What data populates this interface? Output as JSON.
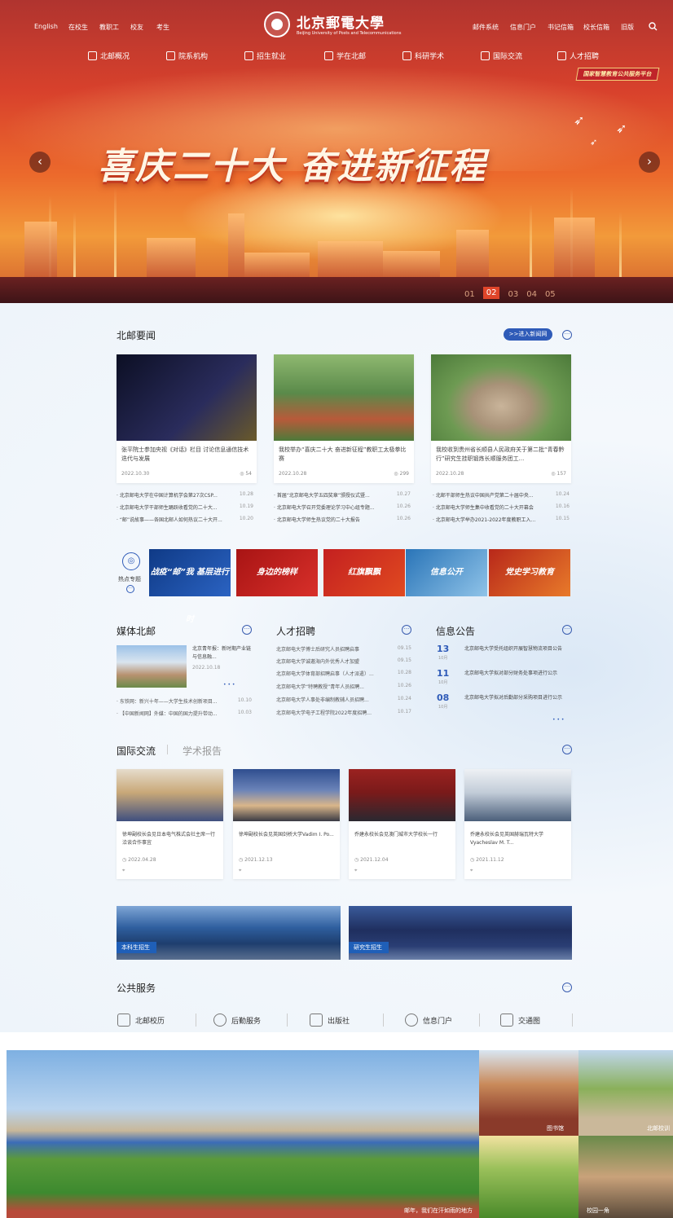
{
  "header": {
    "left_links": [
      "English",
      "在校生",
      "教职工",
      "校友",
      "考生"
    ],
    "logo_cn": "北京郵電大學",
    "logo_en": "Beijing University of Posts and Telecommunications",
    "right_links": [
      "邮件系统",
      "信息门户",
      "书记信箱",
      "校长信箱",
      "旧版"
    ],
    "search_icon": "search-icon"
  },
  "mainnav": [
    "北邮概况",
    "院系机构",
    "招生就业",
    "学在北邮",
    "科研学术",
    "国际交流",
    "人才招聘"
  ],
  "hero": {
    "platform_badge": "国家智慧教育公共服务平台",
    "slogan": "喜庆二十大 奋进新征程",
    "prev": "‹",
    "next": "›",
    "slides": [
      "01",
      "02",
      "03",
      "04",
      "05"
    ],
    "active_slide": "02"
  },
  "news": {
    "title": "北邮要闻",
    "more_pill": ">>进入新闻网",
    "cards": [
      {
        "title": "张平院士参加央视《对话》栏目 讨论信息通信技术迭代与发展",
        "date": "2022.10.30",
        "views": "54",
        "colors": [
          "#0c0f24",
          "#2a2c5c"
        ]
      },
      {
        "title": "我校举办“喜庆二十大 奋进新征程”教职工太极拳比赛",
        "date": "2022.10.28",
        "views": "299",
        "colors": [
          "#5a8a4a",
          "#b85a3a"
        ]
      },
      {
        "title": "我校收到贵州省长顺县人民政府关于第二批“青春黔行”研究生挂职锻炼长顺服务团工...",
        "date": "2022.10.28",
        "views": "157",
        "colors": [
          "#6d9a52",
          "#c9b49a"
        ]
      }
    ],
    "lists": [
      [
        {
          "t": "· 北京邮电大学在中国计算机学会第27次CSP...",
          "d": "10.28"
        },
        {
          "t": "· 北京邮电大学干部师生踊跃收看党的二十大...",
          "d": "10.19"
        },
        {
          "t": "· “邮”说故事——各国北邮人如何热议二十大开...",
          "d": "10.20"
        }
      ],
      [
        {
          "t": "· 首届“北京邮电大学五四奖章”颁授仪式暨...",
          "d": "10.27"
        },
        {
          "t": "· 北京邮电大学召开党委理论学习中心组专题...",
          "d": "10.26"
        },
        {
          "t": "· 北京邮电大学师生热议党的二十大报告",
          "d": "10.26"
        }
      ],
      [
        {
          "t": "· 北邮干部师生热议中国共产党第二十届中央...",
          "d": "10.24"
        },
        {
          "t": "· 北京邮电大学师生集中收看党的二十大开幕会",
          "d": "10.16"
        },
        {
          "t": "· 北京邮电大学举办2021-2022年度教职工入...",
          "d": "10.15"
        }
      ]
    ]
  },
  "topics": {
    "label": "热点专题",
    "banners": [
      {
        "text": "战疫“邮”我 基层进行时",
        "color": "#1a4a9a"
      },
      {
        "text": "身边的榜样",
        "color": "#b81d1d"
      },
      {
        "text": "红旗飘飘",
        "color": "#c42020"
      },
      {
        "text": "信息公开",
        "color": "#3a8ac4"
      },
      {
        "text": "党史学习教育",
        "color": "#c8321f"
      }
    ]
  },
  "media": {
    "title": "媒体北邮",
    "feature_text": "北京青年报：新时期产业链 与信息融...",
    "feature_date": "2022.10.18",
    "items": [
      {
        "t": "· 东铁网：新兴十年——大学生技术创新项目...",
        "d": "10.10"
      },
      {
        "t": "· 【中国新闻网】外媒：中国的国力提升带动...",
        "d": "10.03"
      }
    ]
  },
  "talent": {
    "title": "人才招聘",
    "items": [
      {
        "t": "北京邮电大学博士后研究人员招聘启事",
        "d": "09.15"
      },
      {
        "t": "北京邮电大学诚邀海内外优秀人才加盟",
        "d": "09.15"
      },
      {
        "t": "北京邮电大学体育部招聘启事（人才派遣）...",
        "d": "10.28"
      },
      {
        "t": "北京邮电大学“特聘教授”青年人员招聘...",
        "d": "10.26"
      },
      {
        "t": "北京邮电大学人事处非编制教辅人员招聘...",
        "d": "10.24"
      },
      {
        "t": "北京邮电大学电子工程学院2022年度招聘...",
        "d": "10.17"
      }
    ]
  },
  "notice": {
    "title": "信息公告",
    "items": [
      {
        "day": "13",
        "mon": "10月",
        "t": "北京邮电大学受托组织开展智慧物流项目公告"
      },
      {
        "day": "11",
        "mon": "10月",
        "t": "北京邮电大学拟对部分财务处事项进行公示"
      },
      {
        "day": "08",
        "mon": "10月",
        "t": "北京邮电大学拟对后勤部分采购项目进行公示"
      }
    ]
  },
  "intl": {
    "title": "国际交流",
    "tab2": "学术报告",
    "cards": [
      {
        "t": "徐坤副校长会见日本电气株式会社主席一行洽谈合作事宜",
        "d": "2022.04.28",
        "colors": [
          "#c9a878",
          "#3f4f7f"
        ]
      },
      {
        "t": "徐坤副校长会见英国剑桥大学Vadim I. Po...",
        "d": "2021.12.13",
        "colors": [
          "#2f4e8f",
          "#d9b68a"
        ]
      },
      {
        "t": "乔建永校长会见澳门城市大学校长一行",
        "d": "2021.12.04",
        "colors": [
          "#9b2220",
          "#2a2830"
        ]
      },
      {
        "t": "乔建永校长会见英国赫瑞瓦特大学Vyacheslav M. T...",
        "d": "2021.11.12",
        "colors": [
          "#c2ccd8",
          "#4b5f7a"
        ]
      }
    ]
  },
  "recruit": [
    {
      "label": "本科生招生",
      "colors": [
        "#2f5f9f",
        "#6a8abf"
      ]
    },
    {
      "label": "研究生招生",
      "colors": [
        "#1f2f5f",
        "#3a5a9a"
      ]
    }
  ],
  "services": {
    "title": "公共服务",
    "items": [
      {
        "label": "北邮校历",
        "icon": "calendar-icon"
      },
      {
        "label": "后勤服务",
        "icon": "user-icon"
      },
      {
        "label": "出版社",
        "icon": "book-icon"
      },
      {
        "label": "信息门户",
        "icon": "globe-icon"
      },
      {
        "label": "交通图",
        "icon": "bus-icon"
      }
    ]
  },
  "gallery": {
    "main_caption": "邮年，我们在汗如雨的地方",
    "tiles": [
      {
        "caption": "图书馆"
      },
      {
        "caption": "北邮校训"
      },
      {
        "caption": ""
      },
      {
        "caption": "校园一角"
      }
    ]
  },
  "colors": {
    "accent": "#2f5bb8",
    "hero_red": "#d8412c"
  }
}
